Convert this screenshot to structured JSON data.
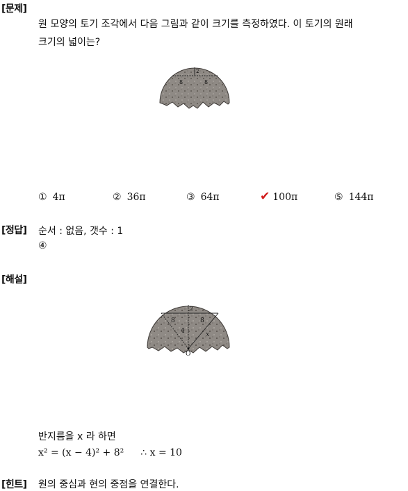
{
  "problem": {
    "label": "[문제]",
    "line1": "원 모양의 토기 조각에서 다음 그림과 같이 크기를 측정하였다. 이 토기의 원래",
    "line2": "크기의 넓이는?",
    "fig_labels": {
      "a": "8",
      "b": "8",
      "c": "2"
    },
    "choices": [
      {
        "num": "①",
        "value": "4π"
      },
      {
        "num": "②",
        "value": "36π"
      },
      {
        "num": "③",
        "value": "64π"
      },
      {
        "num": "④",
        "value": "100π"
      },
      {
        "num": "⑤",
        "value": "144π"
      }
    ],
    "selected_mark": "✔"
  },
  "answer": {
    "label": "[정답]",
    "line1": "순서 : 없음,    갯수 : 1",
    "line2": "④"
  },
  "explanation": {
    "label": "[해설]",
    "fig_labels": {
      "a": "8",
      "b": "8",
      "c": "2",
      "d": "4",
      "x": "x",
      "o": "O"
    },
    "line1": "반지름을 x 라 하면",
    "equation": "x² = (x − 4)² + 8²",
    "therefore": "∴ x = 10"
  },
  "hint": {
    "label": "[힌트]",
    "text": "원의 중심과 현의 중점을 연결한다."
  }
}
